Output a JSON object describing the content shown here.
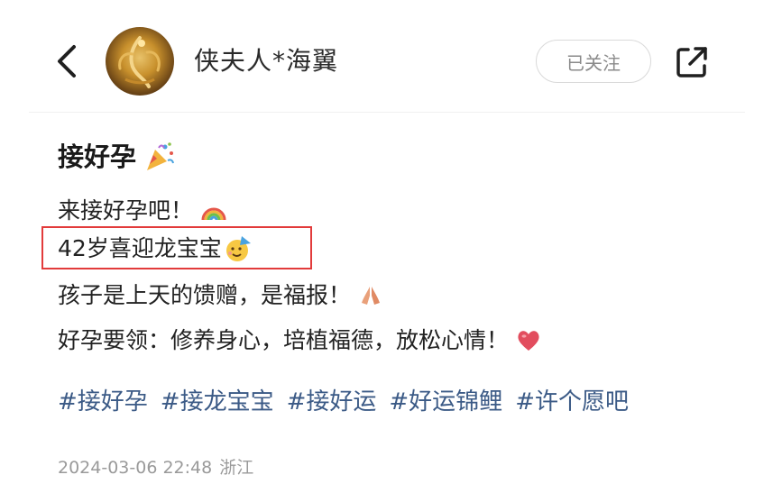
{
  "header": {
    "username": "侠夫人*海翼",
    "follow_label": "已关注"
  },
  "post": {
    "title": "接好孕",
    "lines": [
      "来接好孕吧！",
      "42岁喜迎龙宝宝",
      "孩子是上天的馈赠，是福报！",
      "好孕要领：修养身心，培植福德，放松心情！"
    ],
    "tags": [
      "#接好孕",
      "#接龙宝宝",
      "#接好运",
      "#好运锦鲤",
      "#许个愿吧"
    ],
    "date": "2024-03-06 22:48",
    "location": "浙江"
  },
  "icons": {
    "back": "chevron-left-icon",
    "share": "share-external-icon",
    "title_emoji": "party-popper-icon",
    "line1_emoji": "rainbow-icon",
    "line2_emoji": "partying-face-icon",
    "line3_emoji": "praying-hands-icon",
    "line4_emoji": "heart-icon"
  },
  "colors": {
    "tag": "#3b5a86",
    "highlight": "#e23b3b",
    "meta": "#9a9a9a"
  }
}
